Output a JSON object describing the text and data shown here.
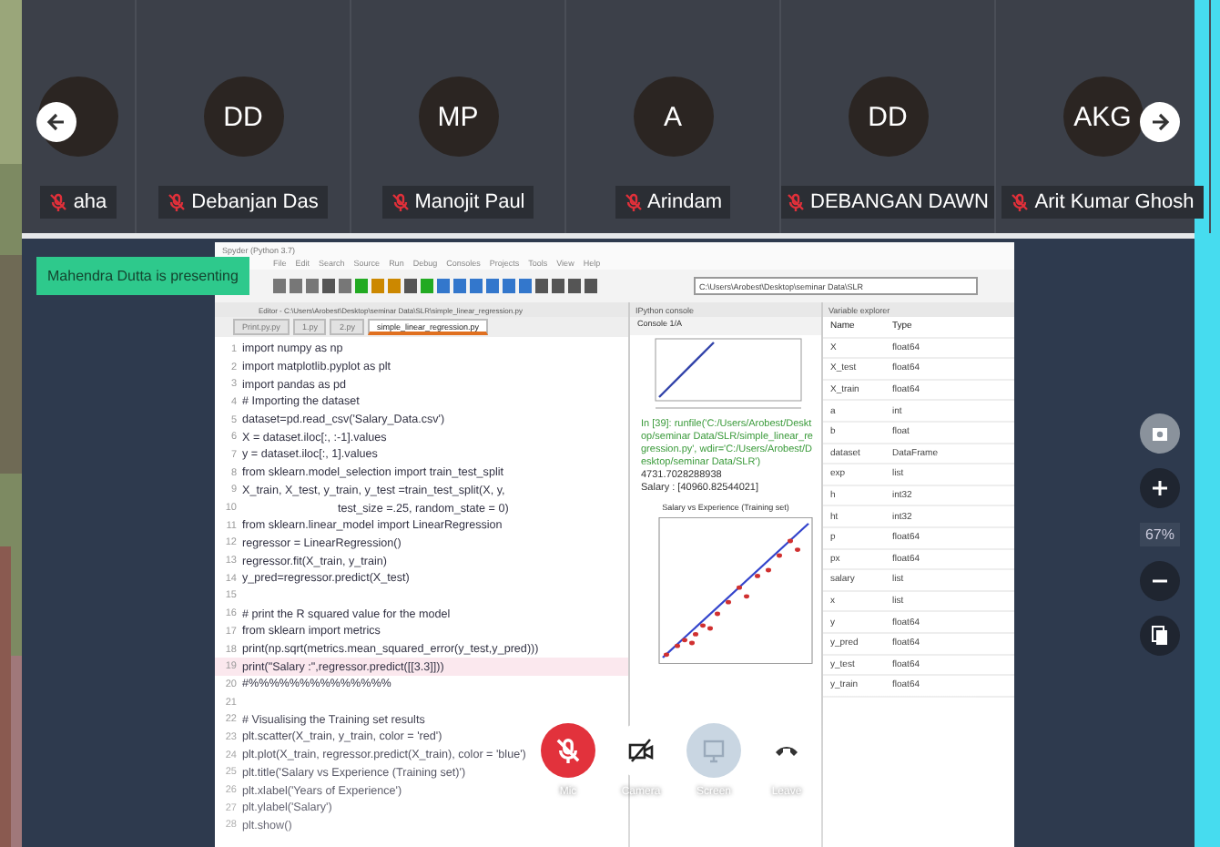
{
  "participants": [
    {
      "name": "aha",
      "mic_muted": true
    },
    {
      "initials": "DD",
      "name": "Debanjan Das",
      "mic_muted": true
    },
    {
      "initials": "MP",
      "name": "Manojit Paul",
      "mic_muted": true
    },
    {
      "initials": "A",
      "name": "Arindam",
      "mic_muted": true
    },
    {
      "initials": "DD",
      "name": "DEBANGAN DAWN",
      "mic_muted": true
    },
    {
      "initials": "AKG",
      "name": "Arit Kumar Ghosh",
      "mic_muted": true
    }
  ],
  "presenter_banner": "Mahendra Dutta is presenting",
  "shared_screen": {
    "title": "Spyder (Python 3.7)",
    "menu": [
      "File",
      "Edit",
      "Search",
      "Source",
      "Run",
      "Debug",
      "Consoles",
      "Projects",
      "Tools",
      "View",
      "Help"
    ],
    "directory": "C:\\Users\\Arobest\\Desktop\\seminar Data\\SLR",
    "editor_path": "Editor - C:\\Users\\Arobest\\Desktop\\seminar Data\\SLR\\simple_linear_regression.py",
    "editor_tabs": [
      {
        "label": "Print.py.py",
        "selected": false
      },
      {
        "label": "1.py",
        "selected": false
      },
      {
        "label": "2.py",
        "selected": false
      },
      {
        "label": "simple_linear_regression.py",
        "selected": true
      }
    ],
    "code_lines": [
      {
        "number": "1",
        "text": "import numpy as np",
        "current": false
      },
      {
        "number": "2",
        "text": "import matplotlib.pyplot as plt",
        "current": false
      },
      {
        "number": "3",
        "text": "import pandas as pd",
        "current": false
      },
      {
        "number": "4",
        "text": "# Importing the dataset",
        "current": false
      },
      {
        "number": "5",
        "text": "dataset=pd.read_csv('Salary_Data.csv')",
        "current": false
      },
      {
        "number": "6",
        "text": "X = dataset.iloc[:, :-1].values",
        "current": false
      },
      {
        "number": "7",
        "text": "y = dataset.iloc[:, 1].values",
        "current": false
      },
      {
        "number": "8",
        "text": "from sklearn.model_selection import train_test_split",
        "current": false
      },
      {
        "number": "9",
        "text": "X_train, X_test, y_train, y_test =train_test_split(X, y,",
        "current": false
      },
      {
        "number": "10",
        "text": "                              test_size =.25, random_state = 0)",
        "current": false
      },
      {
        "number": "11",
        "text": "from sklearn.linear_model import LinearRegression",
        "current": false
      },
      {
        "number": "12",
        "text": "regressor = LinearRegression()",
        "current": false
      },
      {
        "number": "13",
        "text": "regressor.fit(X_train, y_train)",
        "current": false
      },
      {
        "number": "14",
        "text": "y_pred=regressor.predict(X_test)",
        "current": false
      },
      {
        "number": "15",
        "current": false
      },
      {
        "number": "16",
        "text": "# print the R squared value for the model",
        "current": false
      },
      {
        "number": "17",
        "text": "from sklearn import metrics",
        "current": false
      },
      {
        "number": "18",
        "text": "print(np.sqrt(metrics.mean_squared_error(y_test,y_pred)))",
        "current": false
      },
      {
        "number": "19",
        "text": "print(\"Salary :\",regressor.predict([[3.3]]))",
        "current": true
      },
      {
        "number": "20",
        "text": "#%%%%%%%%%%%%%%",
        "current": false
      },
      {
        "number": "21",
        "current": false
      },
      {
        "number": "22",
        "text": "# Visualising the Training set results",
        "current": false
      },
      {
        "number": "23",
        "text": "plt.scatter(X_train, y_train, color = 'red')",
        "current": false
      },
      {
        "number": "24",
        "text": "plt.plot(X_train, regressor.predict(X_train), color = 'blue')",
        "current": false
      },
      {
        "number": "25",
        "text": "plt.title('Salary vs Experience (Training set)')",
        "current": false
      },
      {
        "number": "26",
        "text": "plt.xlabel('Years of Experience')",
        "current": false
      },
      {
        "number": "27",
        "text": "plt.ylabel('Salary')",
        "current": false
      },
      {
        "number": "28",
        "text": "plt.show()",
        "current": false
      }
    ],
    "console": {
      "title": "IPython console",
      "tab": "Console 1/A",
      "output": [
        {
          "kind": "input",
          "text": "In [39]: runfile('C:/Users/Arobest/Desktop/seminar Data/SLR/simple_linear_regression.py', wdir='C:/Users/Arobest/Desktop/seminar Data/SLR')"
        },
        {
          "kind": "plain",
          "text": "4731.7028288938"
        },
        {
          "kind": "plain",
          "text": "Salary : [40960.82544021]"
        }
      ],
      "plot_title": "Salary vs Experience (Training set)"
    },
    "variable_explorer": {
      "title": "Variable explorer",
      "columns": [
        "Name",
        "Type"
      ],
      "rows": [
        [
          "X",
          "float64"
        ],
        [
          "X_test",
          "float64"
        ],
        [
          "X_train",
          "float64"
        ],
        [
          "a",
          "int"
        ],
        [
          "b",
          "float"
        ],
        [
          "dataset",
          "DataFrame"
        ],
        [
          "exp",
          "list"
        ],
        [
          "h",
          "int32"
        ],
        [
          "ht",
          "int32"
        ],
        [
          "p",
          "float64"
        ],
        [
          "px",
          "float64"
        ],
        [
          "salary",
          "list"
        ],
        [
          "x",
          "list"
        ],
        [
          "y",
          "float64"
        ],
        [
          "y_pred",
          "float64"
        ],
        [
          "y_test",
          "float64"
        ],
        [
          "y_train",
          "float64"
        ]
      ]
    }
  },
  "zoom_level": "67%",
  "call_controls": [
    {
      "kind": "mic",
      "label": "Mic"
    },
    {
      "kind": "camera",
      "label": "Camera"
    },
    {
      "kind": "screen",
      "label": "Screen"
    },
    {
      "kind": "leave",
      "label": "Leave"
    }
  ]
}
